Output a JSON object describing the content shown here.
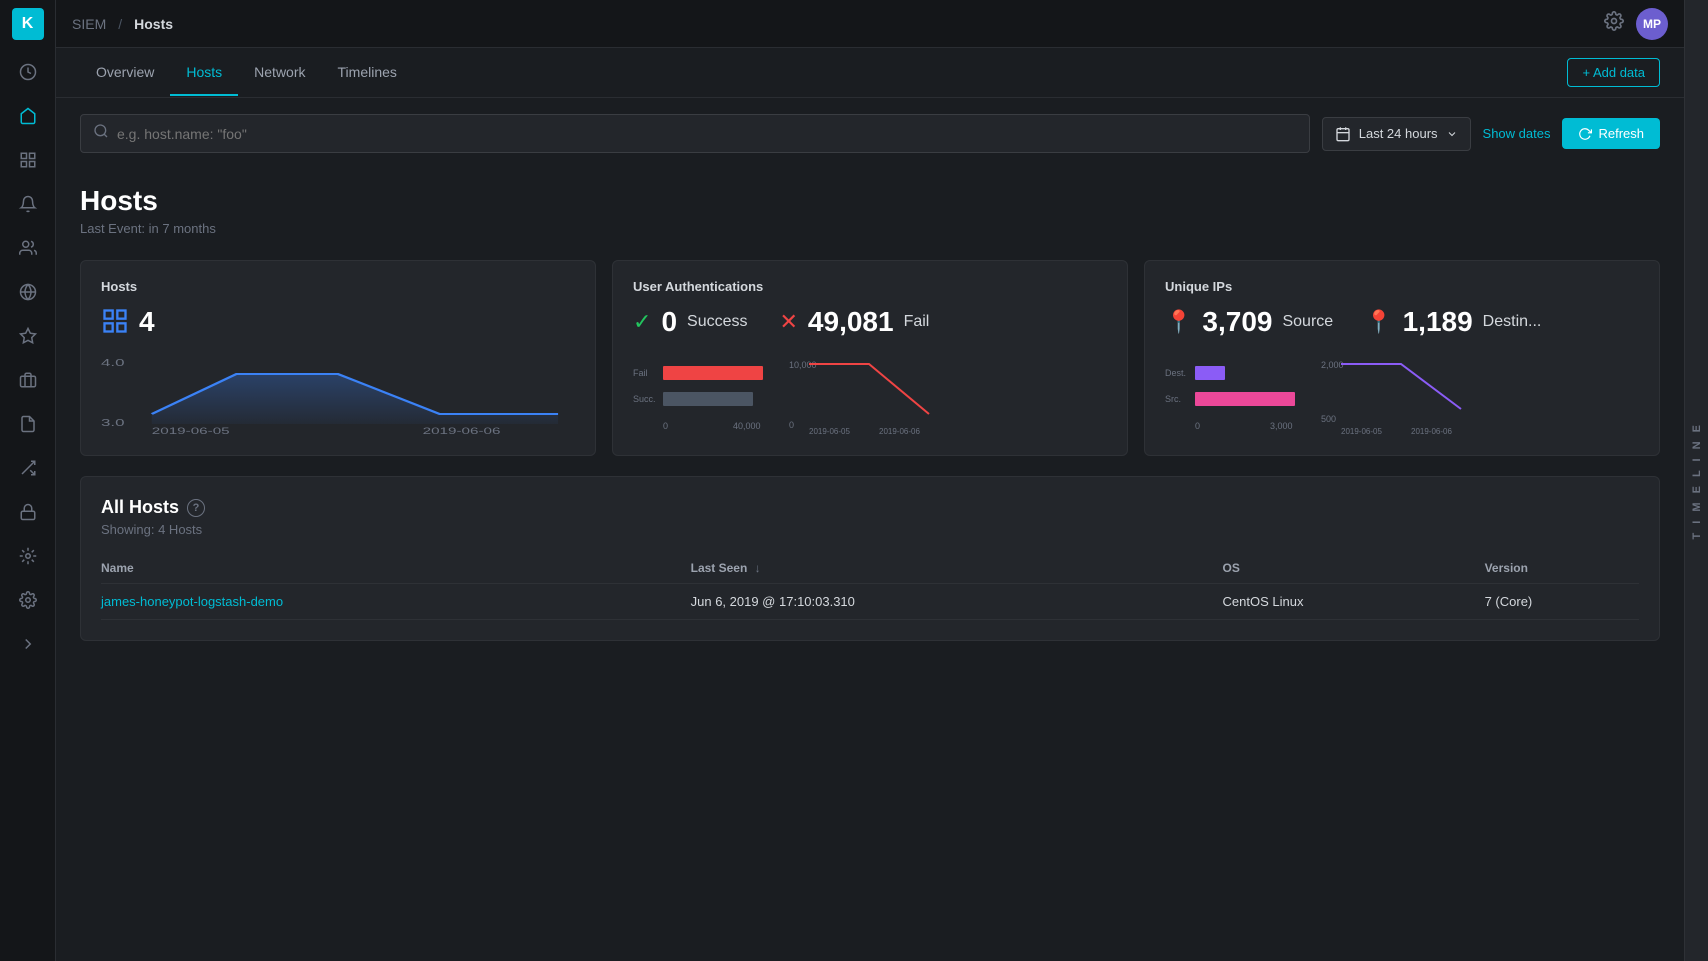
{
  "app": {
    "logo": "K",
    "breadcrumb_siem": "SIEM",
    "breadcrumb_sep": "/",
    "breadcrumb_current": "Hosts",
    "avatar": "MP"
  },
  "nav": {
    "tabs": [
      {
        "label": "Overview",
        "active": false
      },
      {
        "label": "Hosts",
        "active": true
      },
      {
        "label": "Network",
        "active": false
      },
      {
        "label": "Timelines",
        "active": false
      }
    ],
    "add_data_label": "+ Add data"
  },
  "search": {
    "placeholder": "e.g. host.name: \"foo\"",
    "time_range": "Last 24 hours",
    "show_dates_label": "Show dates",
    "refresh_label": "Refresh"
  },
  "hosts_header": {
    "title": "Hosts",
    "last_event": "Last Event: in 7 months"
  },
  "stats": {
    "hosts": {
      "title": "Hosts",
      "count": "4"
    },
    "user_auth": {
      "title": "User Authentications",
      "success_count": "0",
      "success_label": "Success",
      "fail_count": "49,081",
      "fail_label": "Fail"
    },
    "unique_ips": {
      "title": "Unique IPs",
      "source_count": "3,709",
      "source_label": "Source",
      "dest_count": "1,189",
      "dest_label": "Destin..."
    }
  },
  "all_hosts": {
    "title": "All Hosts",
    "showing": "Showing: 4 Hosts",
    "columns": [
      "Name",
      "Last Seen",
      "OS",
      "Version"
    ],
    "rows": [
      {
        "name": "james-honeypot-logstash-demo",
        "last_seen": "Jun 6, 2019 @ 17:10:03.310",
        "os": "CentOS Linux",
        "version": "7 (Core)"
      }
    ]
  },
  "timeline": {
    "label": "T I M E L I N E"
  },
  "sidebar_icons": [
    "⏱",
    "📊",
    "📈",
    "📋",
    "👤",
    "🔔",
    "🎯",
    "📦",
    "📋",
    "🔗",
    "🔒",
    "⚡",
    "🧬",
    "⚙",
    "→"
  ]
}
